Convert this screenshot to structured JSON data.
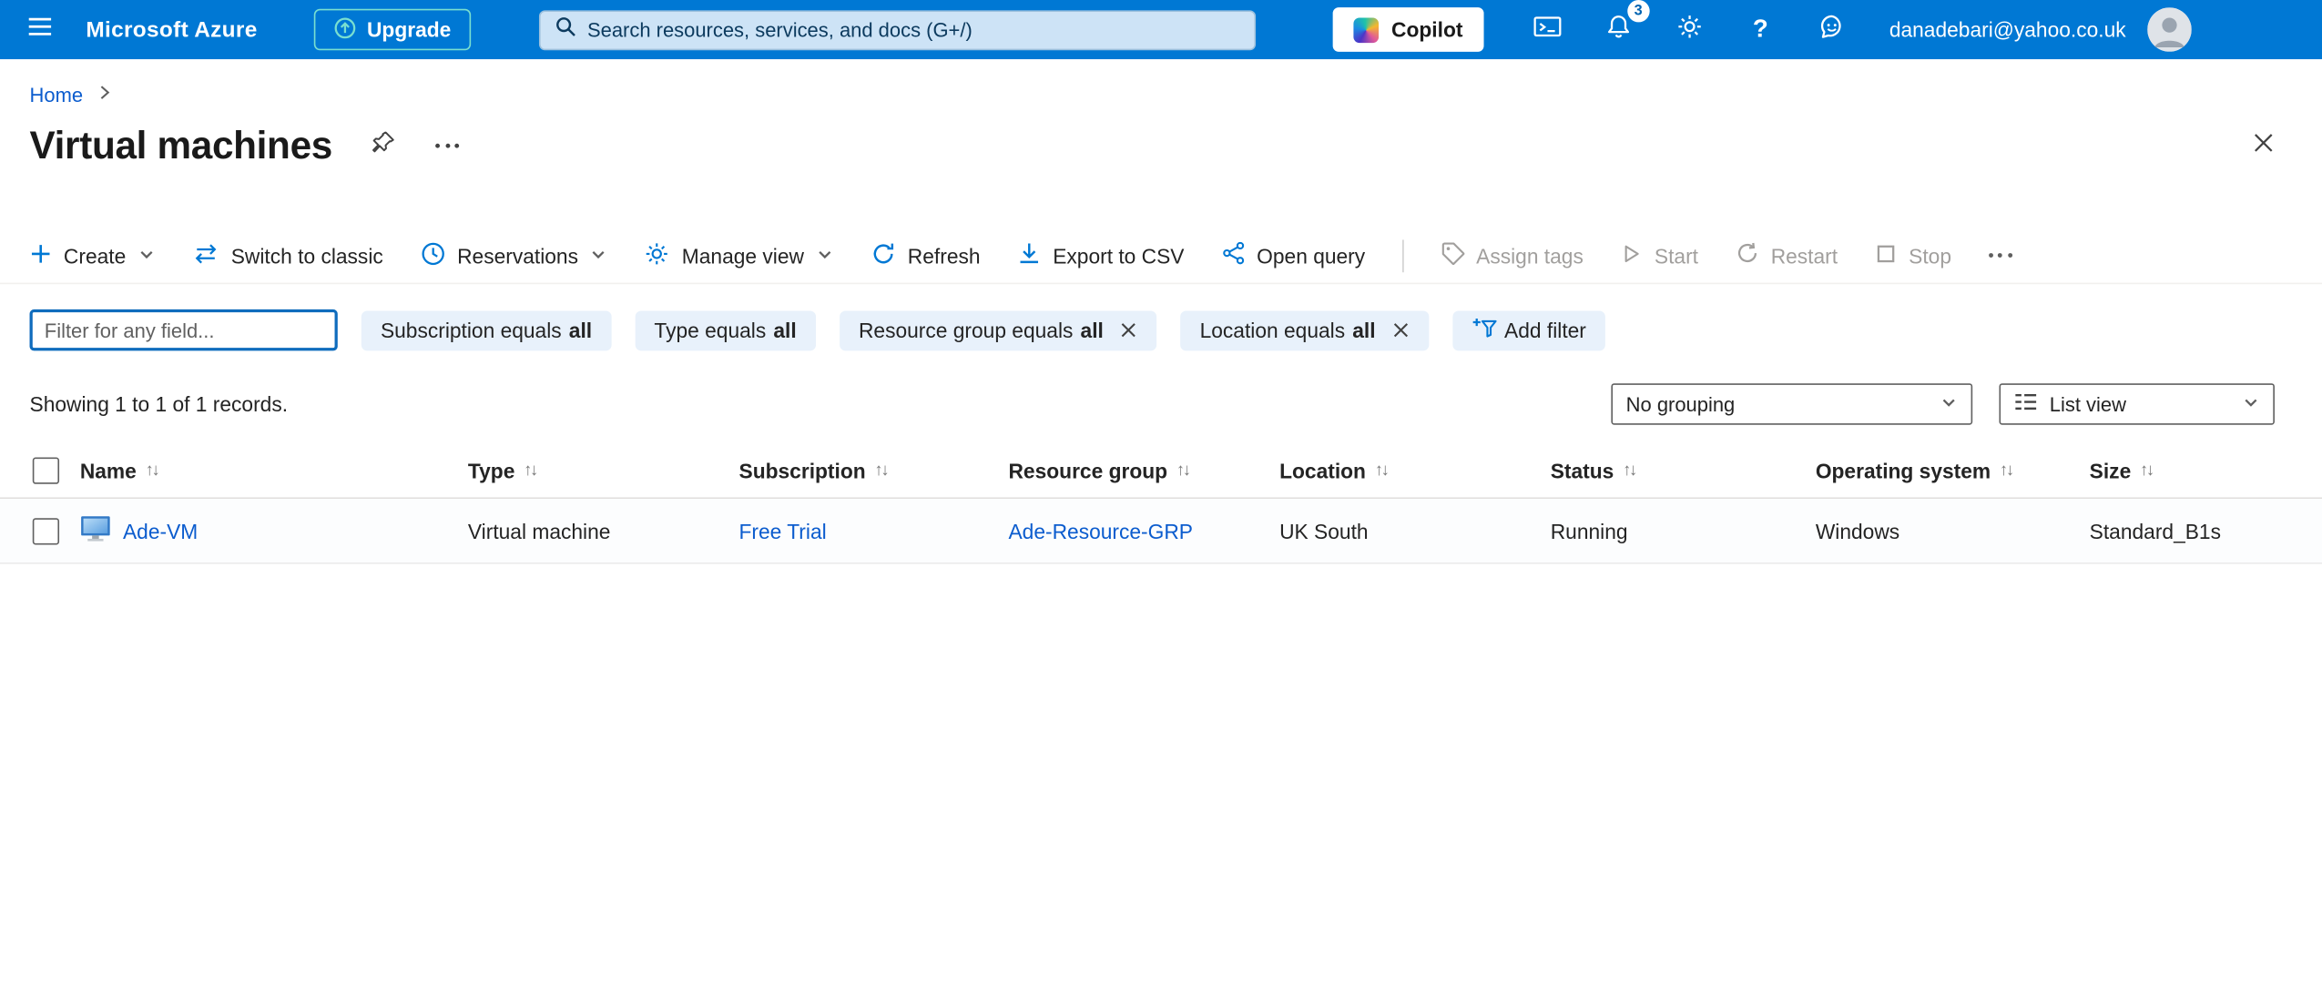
{
  "topbar": {
    "brand": "Microsoft Azure",
    "upgrade_label": "Upgrade",
    "search_placeholder": "Search resources, services, and docs (G+/)",
    "copilot_label": "Copilot",
    "notification_count": "3",
    "help_glyph": "?",
    "email": "danadebari@yahoo.co.uk"
  },
  "breadcrumb": {
    "home": "Home"
  },
  "page": {
    "title": "Virtual machines"
  },
  "toolbar": {
    "items": [
      {
        "label": "Create"
      },
      {
        "label": "Switch to classic"
      },
      {
        "label": "Reservations"
      },
      {
        "label": "Manage view"
      },
      {
        "label": "Refresh"
      },
      {
        "label": "Export to CSV"
      },
      {
        "label": "Open query"
      },
      {
        "label": "Assign tags"
      },
      {
        "label": "Start"
      },
      {
        "label": "Restart"
      },
      {
        "label": "Stop"
      }
    ]
  },
  "filters": {
    "input_placeholder": "Filter for any field...",
    "pills": [
      {
        "label": "Subscription equals",
        "value": "all"
      },
      {
        "label": "Type equals",
        "value": "all"
      },
      {
        "label": "Resource group equals",
        "value": "all"
      },
      {
        "label": "Location equals",
        "value": "all"
      }
    ],
    "add_filter_label": "Add filter"
  },
  "list": {
    "summary": "Showing 1 to 1 of 1 records.",
    "grouping_value": "No grouping",
    "view_value": "List view"
  },
  "table": {
    "sort_glyph": "↑↓",
    "columns": [
      "Name",
      "Type",
      "Subscription",
      "Resource group",
      "Location",
      "Status",
      "Operating system",
      "Size"
    ],
    "rows": [
      {
        "name": "Ade-VM",
        "type": "Virtual machine",
        "subscription": "Free Trial",
        "resource_group": "Ade-Resource-GRP",
        "location": "UK South",
        "status": "Running",
        "os": "Windows",
        "size": "Standard_B1s"
      }
    ]
  },
  "colors": {
    "topbar_bg": "#0078d4",
    "accent": "#0078d4",
    "link": "#0b5cce",
    "disabled": "#a19f9d",
    "pill_bg": "#e8f1fb"
  }
}
